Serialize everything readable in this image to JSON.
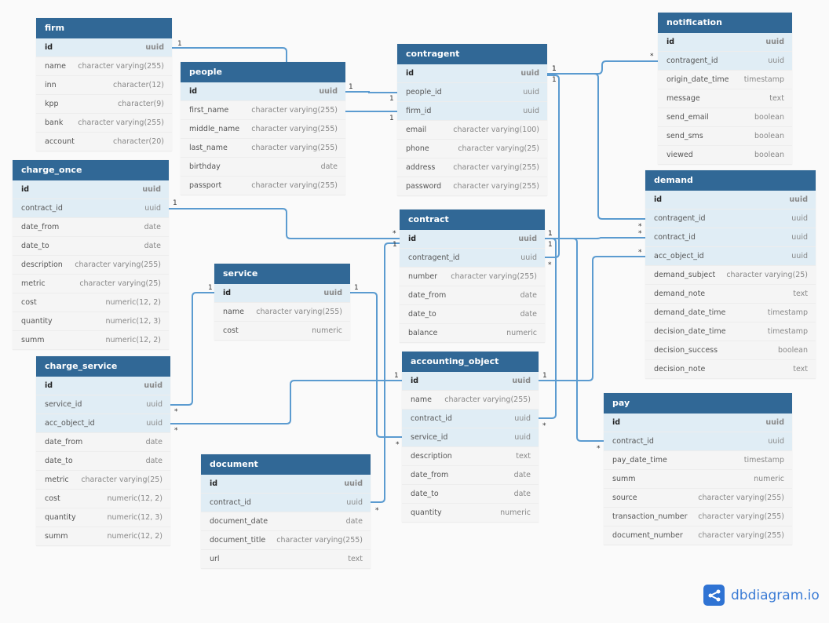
{
  "tables": [
    {
      "name": "firm",
      "columns": [
        [
          "id",
          "uuid",
          "pk"
        ],
        [
          "name",
          "character varying(255)"
        ],
        [
          "inn",
          "character(12)"
        ],
        [
          "kpp",
          "character(9)"
        ],
        [
          "bank",
          "character varying(255)"
        ],
        [
          "account",
          "character(20)"
        ]
      ]
    },
    {
      "name": "people",
      "columns": [
        [
          "id",
          "uuid",
          "pk"
        ],
        [
          "first_name",
          "character varying(255)"
        ],
        [
          "middle_name",
          "character varying(255)"
        ],
        [
          "last_name",
          "character varying(255)"
        ],
        [
          "birthday",
          "date"
        ],
        [
          "passport",
          "character varying(255)"
        ]
      ]
    },
    {
      "name": "contragent",
      "columns": [
        [
          "id",
          "uuid",
          "pk"
        ],
        [
          "people_id",
          "uuid",
          "fk"
        ],
        [
          "firm_id",
          "uuid",
          "fk"
        ],
        [
          "email",
          "character varying(100)"
        ],
        [
          "phone",
          "character varying(25)"
        ],
        [
          "address",
          "character varying(255)"
        ],
        [
          "password",
          "character varying(255)"
        ]
      ]
    },
    {
      "name": "notification",
      "columns": [
        [
          "id",
          "uuid",
          "pk"
        ],
        [
          "contragent_id",
          "uuid",
          "fk"
        ],
        [
          "origin_date_time",
          "timestamp"
        ],
        [
          "message",
          "text"
        ],
        [
          "send_email",
          "boolean"
        ],
        [
          "send_sms",
          "boolean"
        ],
        [
          "viewed",
          "boolean"
        ]
      ]
    },
    {
      "name": "charge_once",
      "columns": [
        [
          "id",
          "uuid",
          "pk"
        ],
        [
          "contract_id",
          "uuid",
          "fk"
        ],
        [
          "date_from",
          "date"
        ],
        [
          "date_to",
          "date"
        ],
        [
          "description",
          "character varying(255)"
        ],
        [
          "metric",
          "character varying(25)"
        ],
        [
          "cost",
          "numeric(12, 2)"
        ],
        [
          "quantity",
          "numeric(12, 3)"
        ],
        [
          "summ",
          "numeric(12, 2)"
        ]
      ]
    },
    {
      "name": "demand",
      "columns": [
        [
          "id",
          "uuid",
          "pk"
        ],
        [
          "contragent_id",
          "uuid",
          "fk"
        ],
        [
          "contract_id",
          "uuid",
          "fk"
        ],
        [
          "acc_object_id",
          "uuid",
          "fk"
        ],
        [
          "demand_subject",
          "character varying(25)"
        ],
        [
          "demand_note",
          "text"
        ],
        [
          "demand_date_time",
          "timestamp"
        ],
        [
          "decision_date_time",
          "timestamp"
        ],
        [
          "decision_success",
          "boolean"
        ],
        [
          "decision_note",
          "text"
        ]
      ]
    },
    {
      "name": "contract",
      "columns": [
        [
          "id",
          "uuid",
          "pk"
        ],
        [
          "contragent_id",
          "uuid",
          "fk"
        ],
        [
          "number",
          "character varying(255)"
        ],
        [
          "date_from",
          "date"
        ],
        [
          "date_to",
          "date"
        ],
        [
          "balance",
          "numeric"
        ]
      ]
    },
    {
      "name": "service",
      "columns": [
        [
          "id",
          "uuid",
          "pk"
        ],
        [
          "name",
          "character varying(255)"
        ],
        [
          "cost",
          "numeric"
        ]
      ]
    },
    {
      "name": "charge_service",
      "columns": [
        [
          "id",
          "uuid",
          "pk"
        ],
        [
          "service_id",
          "uuid",
          "fk"
        ],
        [
          "acc_object_id",
          "uuid",
          "fk"
        ],
        [
          "date_from",
          "date"
        ],
        [
          "date_to",
          "date"
        ],
        [
          "metric",
          "character varying(25)"
        ],
        [
          "cost",
          "numeric(12, 2)"
        ],
        [
          "quantity",
          "numeric(12, 3)"
        ],
        [
          "summ",
          "numeric(12, 2)"
        ]
      ]
    },
    {
      "name": "accounting_object",
      "columns": [
        [
          "id",
          "uuid",
          "pk"
        ],
        [
          "name",
          "character varying(255)"
        ],
        [
          "contract_id",
          "uuid",
          "fk"
        ],
        [
          "service_id",
          "uuid",
          "fk"
        ],
        [
          "description",
          "text"
        ],
        [
          "date_from",
          "date"
        ],
        [
          "date_to",
          "date"
        ],
        [
          "quantity",
          "numeric"
        ]
      ]
    },
    {
      "name": "pay",
      "columns": [
        [
          "id",
          "uuid",
          "pk"
        ],
        [
          "contract_id",
          "uuid",
          "fk"
        ],
        [
          "pay_date_time",
          "timestamp"
        ],
        [
          "summ",
          "numeric"
        ],
        [
          "source",
          "character varying(255)"
        ],
        [
          "transaction_number",
          "character varying(255)"
        ],
        [
          "document_number",
          "character varying(255)"
        ]
      ]
    },
    {
      "name": "document",
      "columns": [
        [
          "id",
          "uuid",
          "pk"
        ],
        [
          "contract_id",
          "uuid",
          "fk"
        ],
        [
          "document_date",
          "date"
        ],
        [
          "document_title",
          "character varying(255)"
        ],
        [
          "url",
          "text"
        ]
      ]
    }
  ],
  "relations": [
    {
      "from": "firm.id",
      "to": "contragent.firm_id",
      "from_card": "1",
      "to_card": "1"
    },
    {
      "from": "people.id",
      "to": "contragent.people_id",
      "from_card": "1",
      "to_card": "1"
    },
    {
      "from": "contragent.id",
      "to": "notification.contragent_id",
      "from_card": "1",
      "to_card": "*"
    },
    {
      "from": "contragent.id",
      "to": "demand.contragent_id",
      "from_card": "1",
      "to_card": "*"
    },
    {
      "from": "contragent.id",
      "to": "contract.contragent_id",
      "from_card": "1",
      "to_card": "*"
    },
    {
      "from": "contract.id",
      "to": "demand.contract_id",
      "from_card": "1",
      "to_card": "*"
    },
    {
      "from": "contract.id",
      "to": "charge_once.contract_id",
      "from_card": "1",
      "to_card": "*"
    },
    {
      "from": "contract.id",
      "to": "document.contract_id",
      "from_card": "1",
      "to_card": "*"
    },
    {
      "from": "service.id",
      "to": "charge_service.service_id",
      "from_card": "1",
      "to_card": "*"
    },
    {
      "from": "service.id",
      "to": "accounting_object.service_id",
      "from_card": "1",
      "to_card": "*"
    },
    {
      "from": "accounting_object.id",
      "to": "charge_service.acc_object_id",
      "from_card": "1",
      "to_card": "*"
    },
    {
      "from": "accounting_object.id",
      "to": "demand.acc_object_id",
      "from_card": "1",
      "to_card": "*"
    },
    {
      "from": "contract.id",
      "to": "accounting_object.contract_id",
      "from_card": "1",
      "to_card": "*"
    },
    {
      "from": "contract.id",
      "to": "pay.contract_id",
      "from_card": "1",
      "to_card": "*"
    }
  ],
  "colors": {
    "header": "#316896",
    "line": "#5b9bd0",
    "highlight": "#e0edf5",
    "brand": "#2f73d3"
  },
  "brand": {
    "name": "dbdiagram.io",
    "icon": "share-nodes-icon"
  }
}
